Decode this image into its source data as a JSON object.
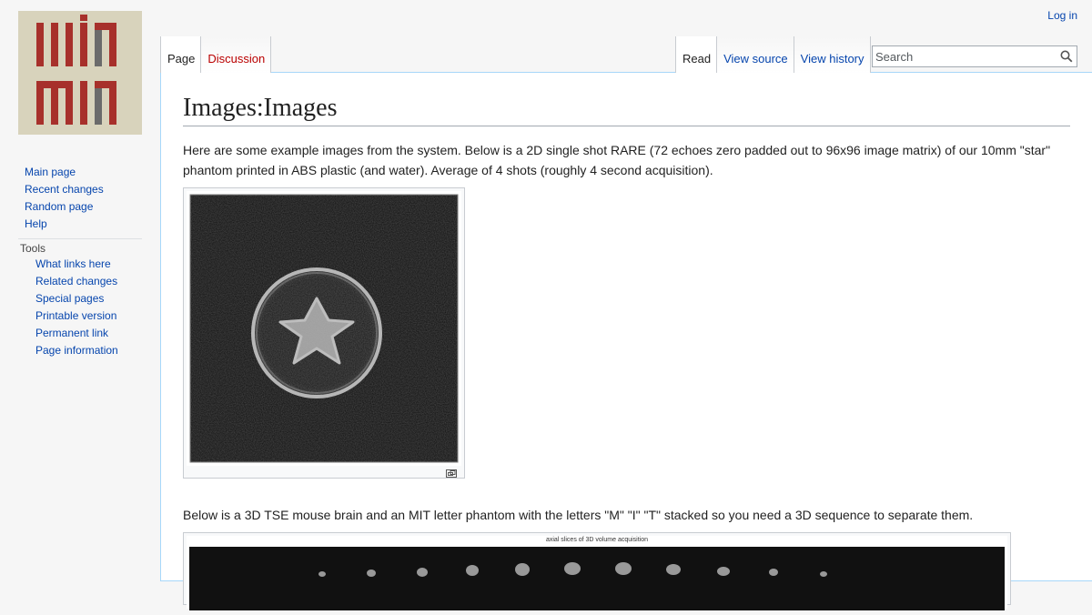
{
  "logo": {
    "label": "MIT MRI logo",
    "colors": {
      "background": "#d8d3bc",
      "red": "#a7302b",
      "gray": "#6b6b6b"
    }
  },
  "personal": {
    "login": "Log in"
  },
  "tabs": {
    "left": [
      {
        "label": "Page",
        "selected": true
      },
      {
        "label": "Discussion",
        "selected": false,
        "new": true
      }
    ],
    "right": [
      {
        "label": "Read",
        "selected": true
      },
      {
        "label": "View source",
        "selected": false
      },
      {
        "label": "View history",
        "selected": false
      }
    ]
  },
  "search": {
    "placeholder": "Search",
    "value": "",
    "icon": "search-icon"
  },
  "sidebar": {
    "main_links": [
      "Main page",
      "Recent changes",
      "Random page",
      "Help"
    ],
    "tools_heading": "Tools",
    "tools_links": [
      "What links here",
      "Related changes",
      "Special pages",
      "Printable version",
      "Permanent link",
      "Page information"
    ]
  },
  "content": {
    "title": "Images:Images",
    "para1": "Here are some example images from the system. Below is a 2D single shot RARE (72 echoes zero padded out to 96x96 image matrix) of our 10mm \"star\" phantom printed in ABS plastic (and water). Average of 4 shots (roughly 4 second acquisition).",
    "para2": "Below is a 3D TSE mouse brain and an MIT letter phantom with the letters \"M\" \"I\" \"T\" stacked so you need a 3D sequence to separate them.",
    "image2_caption": "axial slices of 3D volume acquisition"
  },
  "colors": {
    "link": "#0645ad",
    "new_link": "#ba0000",
    "content_border": "#a7d7f9"
  }
}
